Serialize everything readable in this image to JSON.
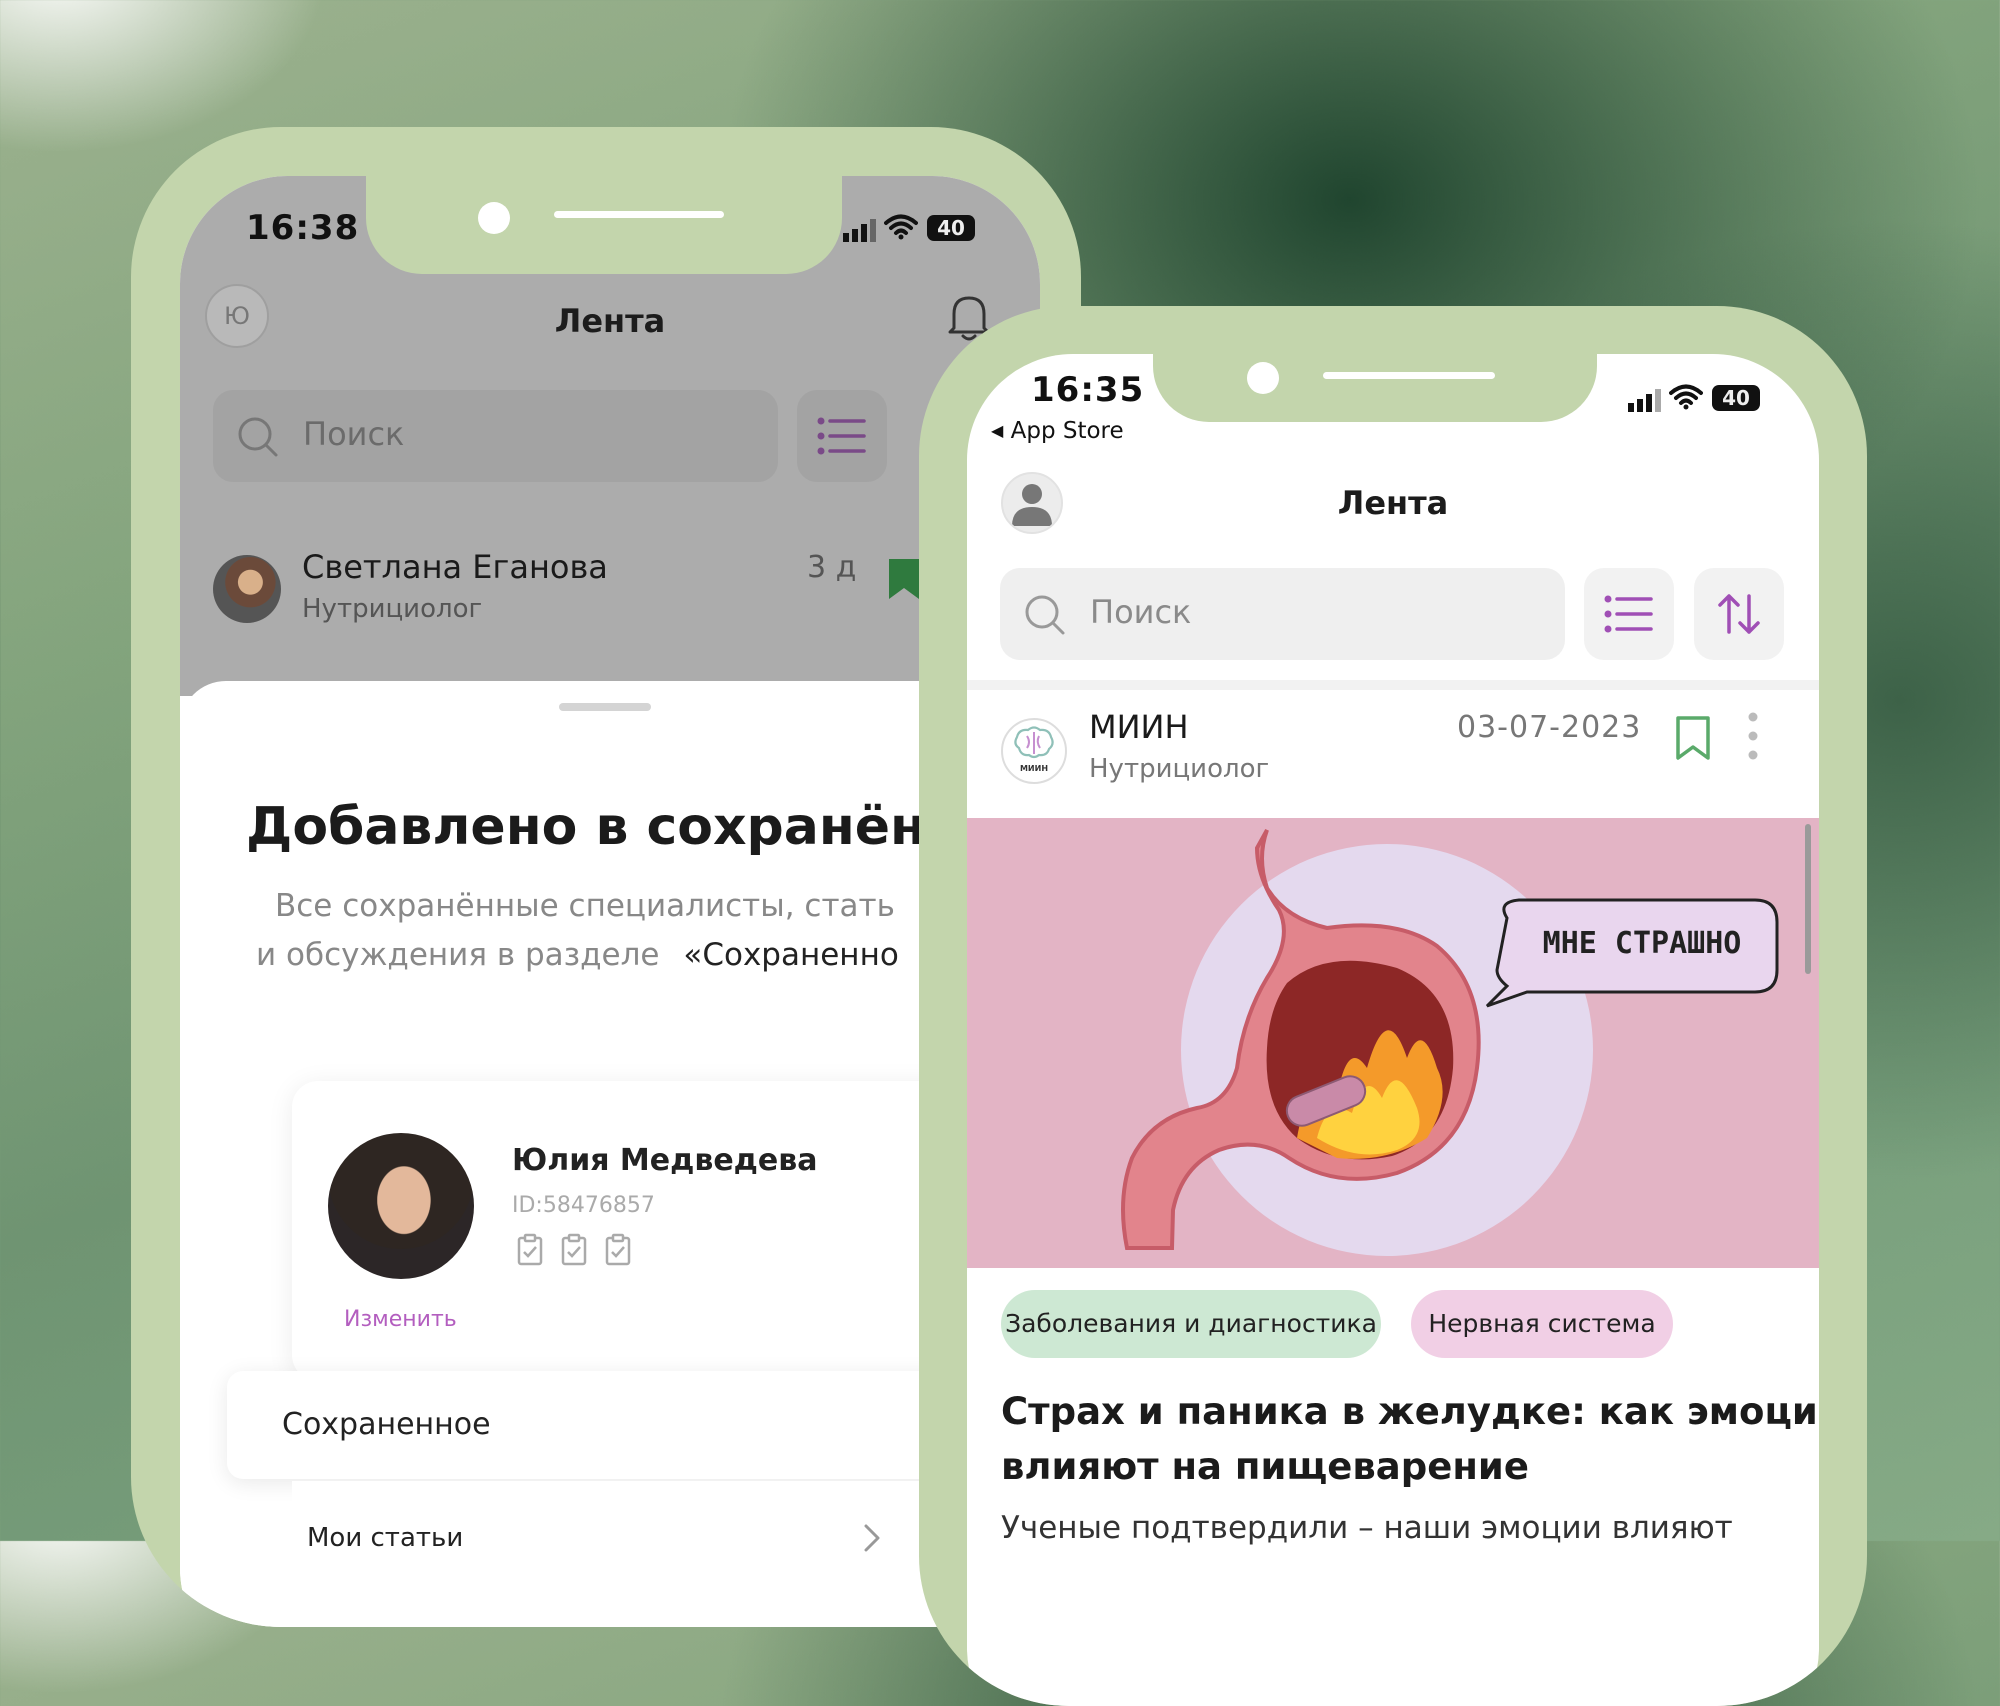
{
  "colors": {
    "frame": "#c3d5ac",
    "accent": "#a04fb5",
    "bookmark": "#5aaa6a",
    "tag_green": "#cde8d3",
    "tag_pink": "#f1cfe5"
  },
  "left_phone": {
    "status": {
      "time": "16:38",
      "battery": "40"
    },
    "header": {
      "avatar_letter": "Ю",
      "title": "Лента",
      "bell_icon": "bell-icon"
    },
    "search": {
      "placeholder": "Поиск"
    },
    "post": {
      "author": "Светлана Еганова",
      "role": "Нутрициолог",
      "age": "3 д"
    },
    "sheet": {
      "title": "Добавлено в сохранённо",
      "text_line1": "Все сохранённые специалисты, стать",
      "text_line2_a": "и обсуждения в разделе",
      "text_line2_b": "«Сохраненно"
    },
    "profile": {
      "name": "Юлия Медведева",
      "id": "ID:58476857",
      "edit_label": "Изменить"
    },
    "menu": {
      "saved": "Сохраненное",
      "my_articles": "Мои статьи"
    }
  },
  "right_phone": {
    "status": {
      "time": "16:35",
      "back_app": "App Store",
      "battery": "40"
    },
    "header": {
      "title": "Лента"
    },
    "search": {
      "placeholder": "Поиск"
    },
    "post": {
      "author": "МИИН",
      "role": "Нутрициолог",
      "date": "03-07-2023",
      "logo_text": "МИИН",
      "image_bubble": "МНЕ СТРАШНО",
      "tags": [
        "Заболевания и диагностика",
        "Нервная система"
      ],
      "title_line1": "Страх и паника в желудке: как эмоции",
      "title_line2": "влияют на пищеварение",
      "excerpt": "Ученые подтвердили – наши эмоции влияют"
    }
  }
}
